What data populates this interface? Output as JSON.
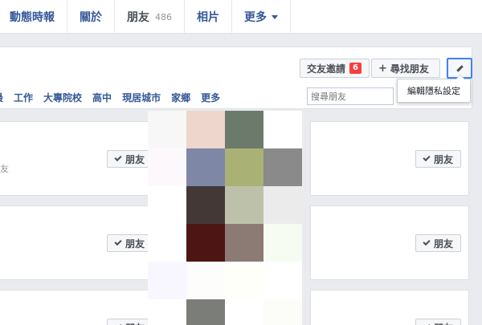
{
  "tabs": [
    {
      "label": "動態時報"
    },
    {
      "label": "關於"
    },
    {
      "label": "朋友",
      "count": "486",
      "active": true
    },
    {
      "label": "相片"
    },
    {
      "label": "更多"
    }
  ],
  "header": {
    "friend_requests_label": "交友邀請",
    "friend_requests_count": "6",
    "find_friends_label": "尋找朋友",
    "edit_privacy_tooltip": "編輯隱私設定"
  },
  "filters": [
    "最",
    "工作",
    "大專院校",
    "高中",
    "現居城市",
    "家鄉",
    "更多"
  ],
  "search": {
    "placeholder": "搜尋朋友"
  },
  "cards": {
    "friend_button_label": "朋友",
    "first_subtext": "友"
  },
  "mosaic_colors": [
    [
      "#f7f7f7",
      "#eed6cd",
      "#6c7a6c",
      "#ffffff"
    ],
    [
      "#fdf8fb",
      "#7e87a6",
      "#a9b175",
      "#8a8a8a"
    ],
    [
      "#ffffff",
      "#443837",
      "#bdc1aa",
      "#ebebeb"
    ],
    [
      "#ffffff",
      "#4d1513",
      "#8c7a74",
      "#f7fcf3"
    ],
    [
      "#f8f7ff",
      "#fdfdfb",
      "#fefff9",
      "#ffffff"
    ],
    [
      "#ffffff",
      "#7b7e78",
      "#ffffff",
      "#fcfdf8"
    ]
  ]
}
